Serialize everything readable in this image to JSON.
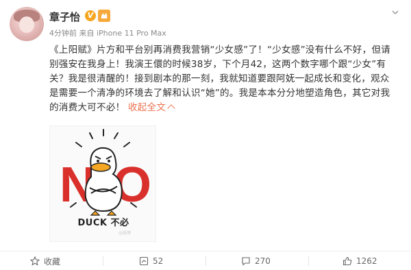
{
  "user": {
    "name": "章子怡",
    "verified_mark": "V",
    "vip_mark": "🔥",
    "meta": "4分钟前 来自 iPhone 11 Pro Max"
  },
  "post": {
    "text_main": "《上阳赋》片方和平台别再消费我营销“少女感”了！“少女感”没有什么不好，但请别强安在我身上！我演王儇的时候38岁，下个月42，这两个数字哪个跟“少女”有关？我是很清醒的！接到剧本的那一刻，我就知道要跟阿妩一起成长和变化，观众是需要一个清净的环境去了解和认识“她”的。我是本本分分地塑造角色，其它对我的消费大可不必！",
    "expand_label": "收起全文"
  },
  "image": {
    "big_text": "NO",
    "caption": "DUCK 不必",
    "watermark": "@微博"
  },
  "footer": {
    "favorite_label": "收藏",
    "repost_count": "52",
    "comment_count": "270",
    "like_count": "1262"
  },
  "colors": {
    "accent": "#eb7350",
    "no_red": "#d9302c",
    "text": "#333333",
    "meta": "#8a8a8a"
  },
  "icons": {
    "more": "chevron-down-icon",
    "favorite": "star-icon",
    "repost": "repost-icon",
    "comment": "comment-icon",
    "like": "thumbs-up-icon"
  }
}
